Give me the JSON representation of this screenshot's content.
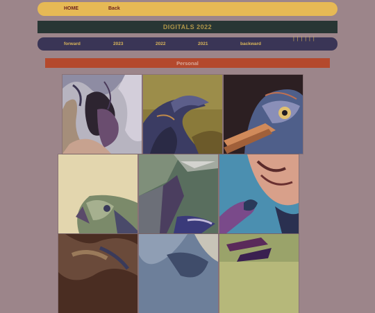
{
  "topnav": {
    "home": "HOME",
    "back": "Back"
  },
  "header": {
    "title": "DIGITALS 2022"
  },
  "yearnav": {
    "forward": "forward",
    "y2023": "2023",
    "y2022": "2022",
    "y2021": "2021",
    "backward": "backward",
    "pipes": "| | | | | |"
  },
  "section": {
    "label": "Personal"
  },
  "gallery": {
    "items": [
      "abstract-portrait-swirl",
      "bird-crest-golden",
      "bird-heron-eye-dark",
      "bird-cream-abstract",
      "geometric-gray-green",
      "bird-on-branch-blue",
      "brown-texture",
      "blue-gray-texture",
      "green-purple-shapes"
    ]
  }
}
